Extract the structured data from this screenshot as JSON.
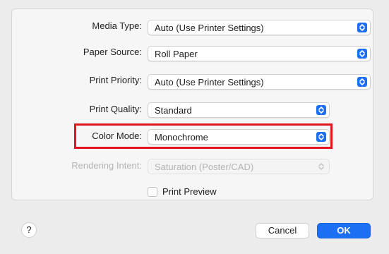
{
  "settings": {
    "media_type": {
      "label": "Media Type:",
      "value": "Auto (Use Printer Settings)"
    },
    "paper_source": {
      "label": "Paper Source:",
      "value": "Roll Paper"
    },
    "print_priority": {
      "label": "Print Priority:",
      "value": "Auto (Use Printer Settings)"
    },
    "print_quality": {
      "label": "Print Quality:",
      "value": "Standard"
    },
    "color_mode": {
      "label": "Color Mode:",
      "value": "Monochrome"
    },
    "rendering_intent": {
      "label": "Rendering Intent:",
      "value": "Saturation (Poster/CAD)",
      "disabled": true
    }
  },
  "print_preview": {
    "label": "Print Preview",
    "checked": false
  },
  "footer": {
    "help_label": "?",
    "cancel_label": "Cancel",
    "ok_label": "OK"
  },
  "colors": {
    "accent": "#1c6ef2",
    "highlight": "#e2141f"
  }
}
